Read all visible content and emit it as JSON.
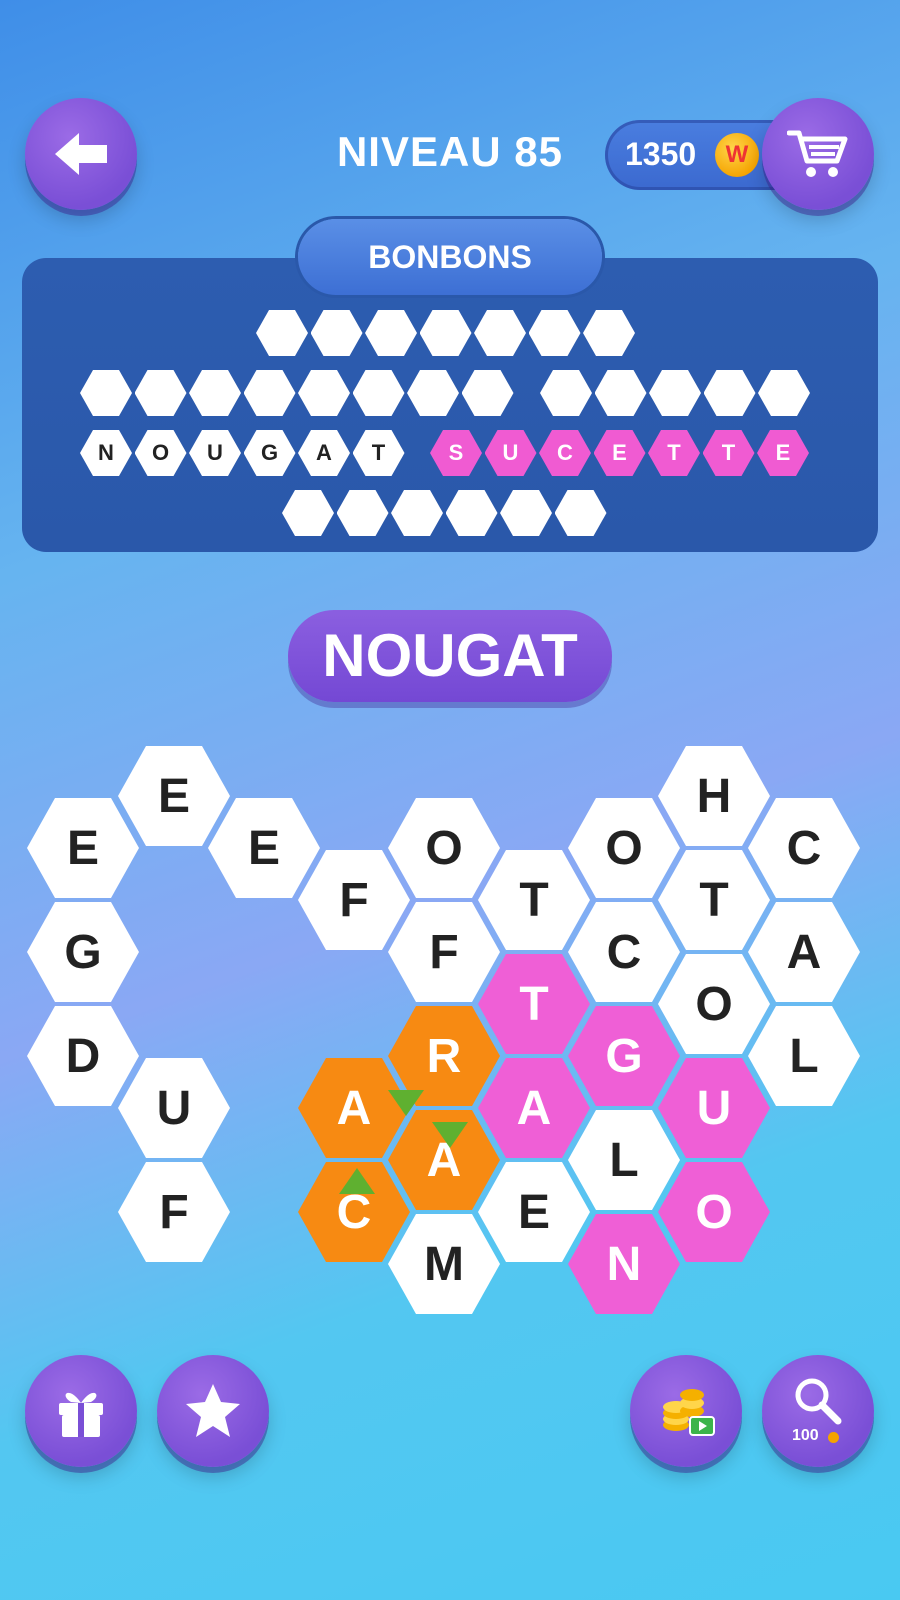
{
  "header": {
    "level_title": "NIVEAU 85",
    "coins": "1350",
    "coin_symbol": "W"
  },
  "panel": {
    "category": "BONBONS",
    "rows": [
      {
        "words": [
          {
            "letters": [
              "",
              "",
              "",
              "",
              "",
              "",
              ""
            ],
            "found": false
          }
        ]
      },
      {
        "words": [
          {
            "letters": [
              "",
              "",
              "",
              "",
              "",
              "",
              "",
              ""
            ],
            "found": false
          },
          {
            "letters": [
              "",
              "",
              "",
              "",
              ""
            ],
            "found": false
          }
        ]
      },
      {
        "words": [
          {
            "letters": [
              "N",
              "O",
              "U",
              "G",
              "A",
              "T"
            ],
            "found": true,
            "color": "white"
          },
          {
            "letters": [
              "S",
              "U",
              "C",
              "E",
              "T",
              "T",
              "E"
            ],
            "found": true,
            "color": "pink"
          }
        ]
      },
      {
        "words": [
          {
            "letters": [
              "",
              "",
              "",
              "",
              "",
              ""
            ],
            "found": false
          }
        ]
      }
    ]
  },
  "current_word": "NOUGAT",
  "grid": [
    {
      "letter": "E",
      "color": "white"
    },
    {
      "letter": "E",
      "color": "white"
    },
    {
      "letter": "G",
      "color": "white"
    },
    {
      "letter": "D",
      "color": "white"
    },
    {
      "letter": "U",
      "color": "white"
    },
    {
      "letter": "F",
      "color": "white"
    },
    {
      "letter": "E",
      "color": "white"
    },
    {
      "letter": "F",
      "color": "white"
    },
    {
      "letter": "O",
      "color": "white"
    },
    {
      "letter": "F",
      "color": "white"
    },
    {
      "letter": "T",
      "color": "white"
    },
    {
      "letter": "T",
      "color": "pink"
    },
    {
      "letter": "R",
      "color": "orange"
    },
    {
      "letter": "A",
      "color": "orange"
    },
    {
      "letter": "A",
      "color": "orange"
    },
    {
      "letter": "C",
      "color": "orange"
    },
    {
      "letter": "M",
      "color": "white"
    },
    {
      "letter": "A",
      "color": "pink"
    },
    {
      "letter": "E",
      "color": "white"
    },
    {
      "letter": "O",
      "color": "white"
    },
    {
      "letter": "C",
      "color": "white"
    },
    {
      "letter": "G",
      "color": "pink"
    },
    {
      "letter": "L",
      "color": "white"
    },
    {
      "letter": "N",
      "color": "pink"
    },
    {
      "letter": "H",
      "color": "white"
    },
    {
      "letter": "T",
      "color": "white"
    },
    {
      "letter": "O",
      "color": "white"
    },
    {
      "letter": "U",
      "color": "pink"
    },
    {
      "letter": "O",
      "color": "pink"
    },
    {
      "letter": "C",
      "color": "white"
    },
    {
      "letter": "A",
      "color": "white"
    },
    {
      "letter": "L",
      "color": "white"
    }
  ],
  "toolbar": {
    "gift": "gift-icon",
    "star": "star-icon",
    "coins_video": "coins-video-icon",
    "hint": "magnifier-icon",
    "hint_cost": "100"
  }
}
